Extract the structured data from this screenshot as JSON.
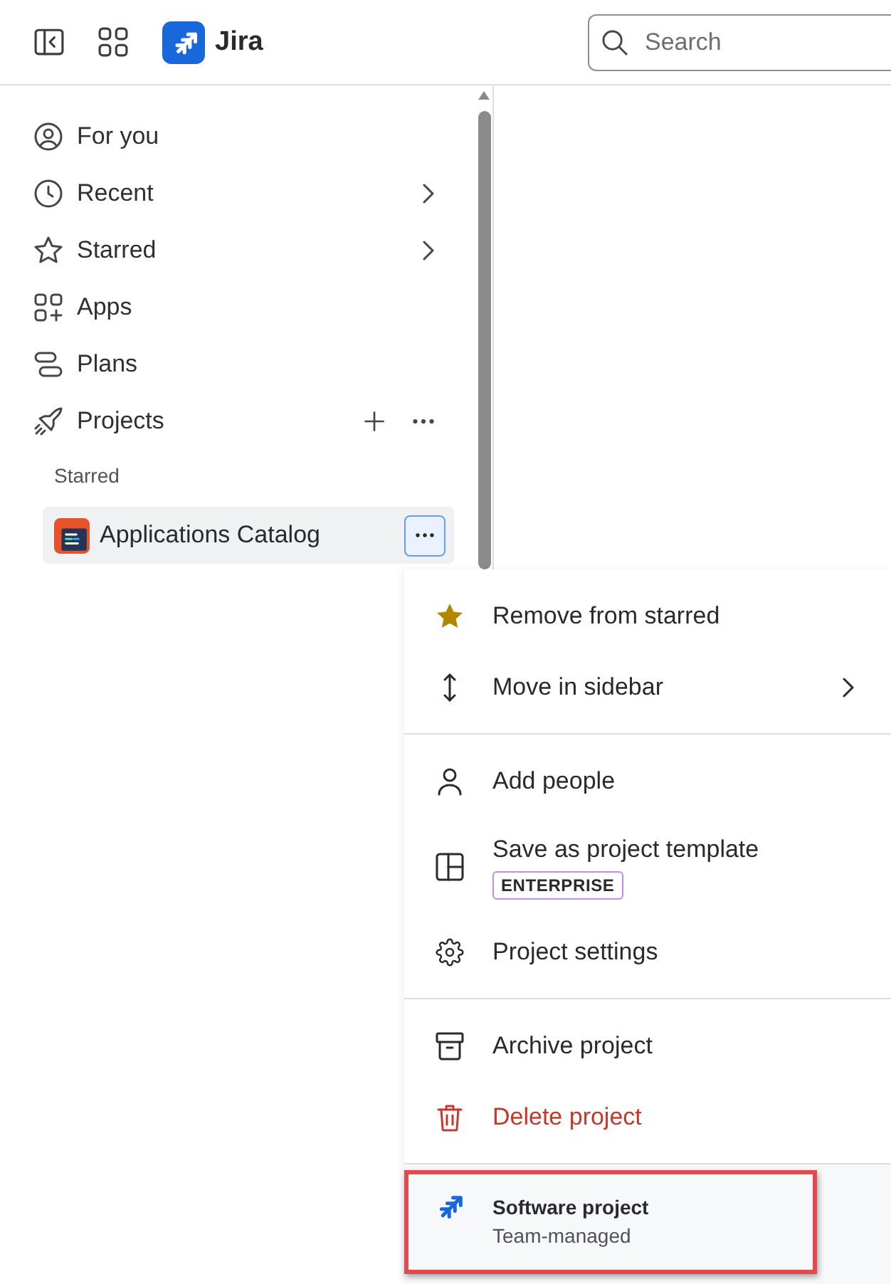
{
  "header": {
    "product": "Jira",
    "search": {
      "placeholder": "Search"
    }
  },
  "sidebar": {
    "items": [
      {
        "label": "For you",
        "has_submenu": false,
        "has_actions": false
      },
      {
        "label": "Recent",
        "has_submenu": true,
        "has_actions": false
      },
      {
        "label": "Starred",
        "has_submenu": true,
        "has_actions": false
      },
      {
        "label": "Apps",
        "has_submenu": false,
        "has_actions": false
      },
      {
        "label": "Plans",
        "has_submenu": false,
        "has_actions": false
      },
      {
        "label": "Projects",
        "has_submenu": false,
        "has_actions": true
      }
    ],
    "starred": {
      "title": "Starred",
      "items": [
        {
          "label": "Applications Catalog",
          "menu_open": true
        }
      ]
    }
  },
  "menu": {
    "groups": [
      {
        "items": [
          {
            "label": "Remove from starred",
            "has_submenu": false,
            "danger": false
          },
          {
            "label": "Move in sidebar",
            "has_submenu": true,
            "danger": false
          }
        ]
      },
      {
        "items": [
          {
            "label": "Add people",
            "has_submenu": false,
            "danger": false
          },
          {
            "label": "Save as project template",
            "badge": "ENTERPRISE",
            "has_submenu": false,
            "danger": false
          },
          {
            "label": "Project settings",
            "has_submenu": false,
            "danger": false
          }
        ]
      },
      {
        "items": [
          {
            "label": "Archive project",
            "has_submenu": false,
            "danger": false
          },
          {
            "label": "Delete project",
            "has_submenu": false,
            "danger": true
          }
        ]
      }
    ],
    "footer": {
      "title": "Software project",
      "subtitle": "Team-managed",
      "highlighted": true
    }
  }
}
